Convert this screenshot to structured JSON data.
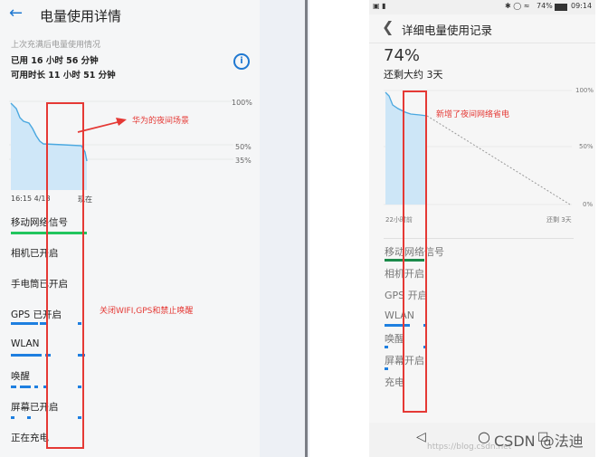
{
  "left_phone": {
    "title": "电量使用详情",
    "subtitle": "上次充满后电量使用情况",
    "used_time": "已用 16 小时 56 分钟",
    "remaining_time": "可用时长 11 小时 51 分钟",
    "info_icon": "info-icon",
    "chart": {
      "pct_100": "100%",
      "pct_50": "50%",
      "pct_35": "35%",
      "x_start": "16:15  4/18",
      "x_now": "现在"
    },
    "categories": [
      "移动网络信号",
      "相机已开启",
      "手电筒已开启",
      "GPS 已开启",
      "WLAN",
      "唤醒",
      "屏幕已开启",
      "正在充电"
    ]
  },
  "right_phone": {
    "status_time": "09:14",
    "status_battery": "74%",
    "title": "详细电量使用记录",
    "percent": "74%",
    "remaining": "还剩大约 3天",
    "chart": {
      "pct_100": "100%",
      "pct_50": "50%",
      "pct_0": "0%",
      "x_start": "22小时前",
      "x_end": "还剩 3天"
    },
    "categories": [
      "移动网络信号",
      "相机开启",
      "GPS 开启",
      "WLAN",
      "唤醒",
      "屏幕开启",
      "充电"
    ]
  },
  "annotations": {
    "huawei_night": "华为的夜间场景",
    "disable_wifi": "关闭WIFI,GPS和禁止唤醒",
    "added_night_saving": "新增了夜间网络省电"
  },
  "watermark": {
    "csdn": "CSDN @法迪",
    "blog": "https://blog.csdn.net"
  },
  "colors": {
    "accent_blue": "#1f78d1",
    "annotation_red": "#e53935",
    "mobile_signal_green_left": "#22c55e",
    "mobile_signal_green_right": "#1b8a4a"
  }
}
